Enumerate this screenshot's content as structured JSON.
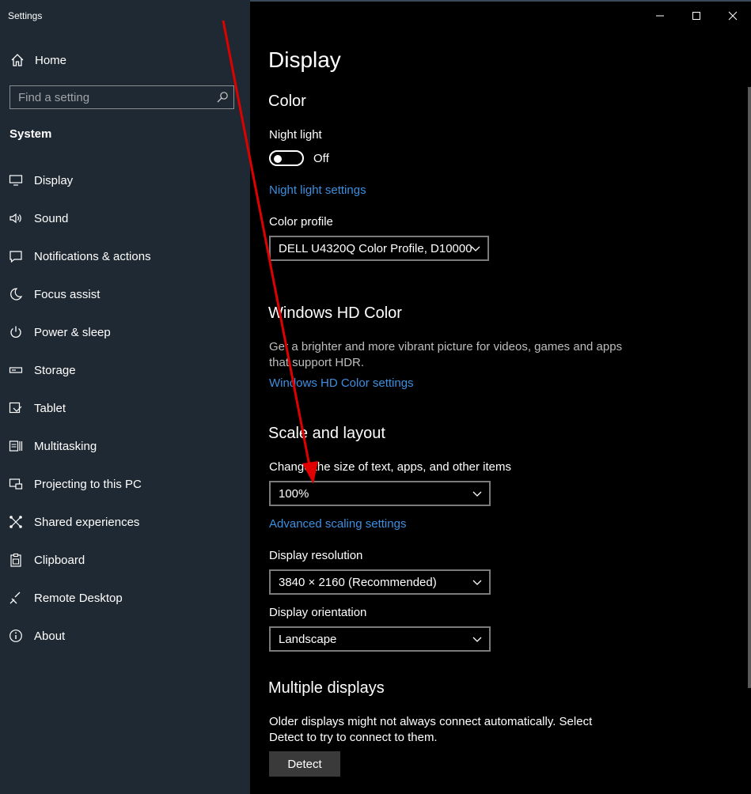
{
  "app": {
    "title": "Settings"
  },
  "sidebar": {
    "home_label": "Home",
    "search_placeholder": "Find a setting",
    "section": "System",
    "items": [
      {
        "label": "Display",
        "icon": "monitor-icon"
      },
      {
        "label": "Sound",
        "icon": "speaker-icon"
      },
      {
        "label": "Notifications & actions",
        "icon": "notification-icon"
      },
      {
        "label": "Focus assist",
        "icon": "moon-icon"
      },
      {
        "label": "Power & sleep",
        "icon": "power-icon"
      },
      {
        "label": "Storage",
        "icon": "storage-icon"
      },
      {
        "label": "Tablet",
        "icon": "tablet-icon"
      },
      {
        "label": "Multitasking",
        "icon": "multitasking-icon"
      },
      {
        "label": "Projecting to this PC",
        "icon": "projector-icon"
      },
      {
        "label": "Shared experiences",
        "icon": "shared-icon"
      },
      {
        "label": "Clipboard",
        "icon": "clipboard-icon"
      },
      {
        "label": "Remote Desktop",
        "icon": "remote-icon"
      },
      {
        "label": "About",
        "icon": "info-icon"
      }
    ]
  },
  "main": {
    "title": "Display",
    "color": {
      "heading": "Color",
      "night_light_label": "Night light",
      "night_light_state": "Off",
      "night_light_link": "Night light settings",
      "profile_label": "Color profile",
      "profile_value": "DELL U4320Q Color Profile, D10000"
    },
    "hd": {
      "heading": "Windows HD Color",
      "description": "Get a brighter and more vibrant picture for videos, games and apps that support HDR.",
      "link": "Windows HD Color settings"
    },
    "scale": {
      "heading": "Scale and layout",
      "size_label": "Change the size of text, apps, and other items",
      "size_value": "100%",
      "advanced_link": "Advanced scaling settings",
      "resolution_label": "Display resolution",
      "resolution_value": "3840 × 2160 (Recommended)",
      "orientation_label": "Display orientation",
      "orientation_value": "Landscape"
    },
    "multiple": {
      "heading": "Multiple displays",
      "description": "Older displays might not always connect automatically. Select Detect to try to connect to them.",
      "detect_label": "Detect"
    }
  },
  "colors": {
    "sidebar_bg": "#1f2933",
    "accent_link": "#3d8fe0",
    "annotation_arrow": "#e00000"
  }
}
